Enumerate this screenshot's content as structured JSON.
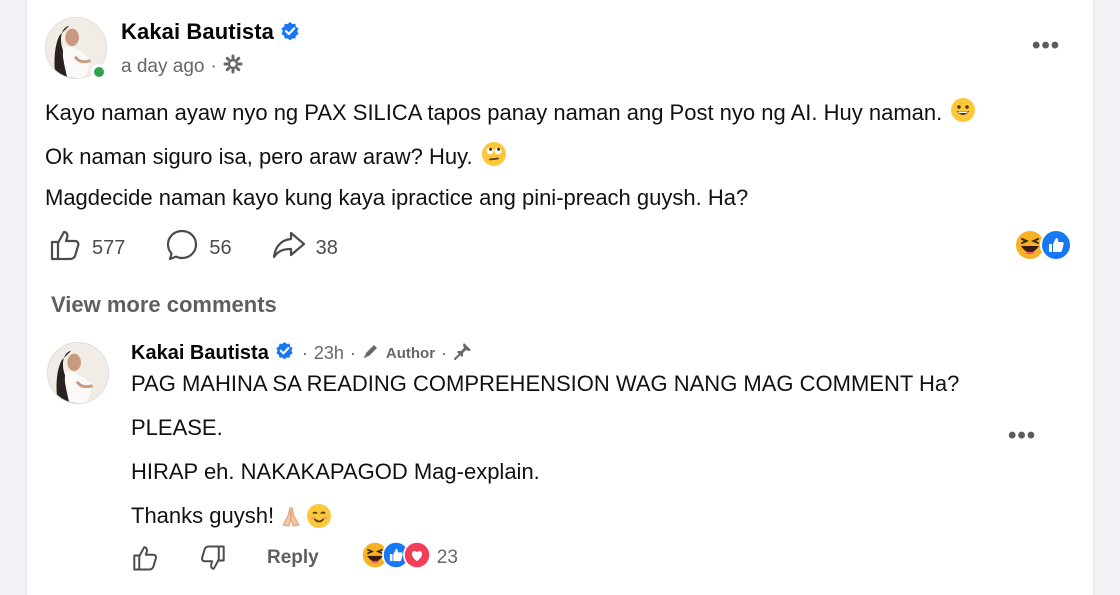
{
  "post": {
    "author": "Kakai Bautista",
    "time": "a day ago",
    "separator": "·",
    "lines": [
      "Kayo naman ayaw nyo ng PAX SILICA tapos panay naman ang Post nyo ng AI. Huy naman.",
      "Ok naman siguro isa, pero araw araw? Huy.",
      "Magdecide naman kayo kung kaya ipractice ang pini-preach guysh. Ha?"
    ],
    "likes": "577",
    "comments": "56",
    "shares": "38",
    "more_label": "•••"
  },
  "view_more_comments": "View more comments",
  "comment": {
    "author": "Kakai Bautista",
    "time": "23h",
    "separator": "·",
    "author_label": "Author",
    "lines": [
      "PAG MAHINA SA READING COMPREHENSION WAG NANG MAG COMMENT Ha?",
      "PLEASE.",
      "HIRAP eh. NAKAKAPAGOD Mag-explain.",
      "Thanks guysh!"
    ],
    "reply_label": "Reply",
    "reaction_count": "23",
    "more_label": "•••"
  },
  "colors": {
    "verified": "#1877f2",
    "online": "#31a24c",
    "like_blue": "#1877f2",
    "love_red": "#f33e58",
    "emoji_yellow": "#f7b125"
  },
  "icons": [
    "verified-icon",
    "globe-settings-icon",
    "like-icon",
    "comment-icon",
    "share-icon",
    "haha-icon",
    "like-reaction-icon",
    "love-reaction-icon",
    "pin-icon",
    "author-pen-icon",
    "dislike-icon"
  ]
}
